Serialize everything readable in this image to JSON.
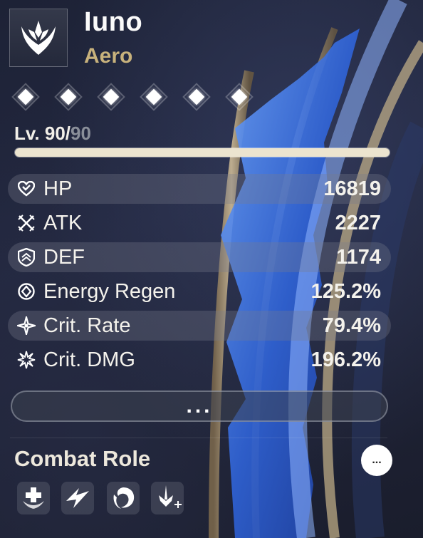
{
  "character": {
    "name": "Iuno",
    "element": "Aero",
    "emblem_icon": "aero-emblem-icon"
  },
  "sequence": {
    "nodes": [
      {
        "icon": "sequence-diamond-icon",
        "active": true
      },
      {
        "icon": "sequence-diamond-icon",
        "active": true
      },
      {
        "icon": "sequence-diamond-icon",
        "active": true
      },
      {
        "icon": "sequence-diamond-icon",
        "active": true
      },
      {
        "icon": "sequence-diamond-icon",
        "active": true
      },
      {
        "icon": "sequence-diamond-icon",
        "active": true
      }
    ]
  },
  "level": {
    "prefix": "Lv. 90/",
    "max": "90",
    "progress_percent": 100
  },
  "stats": [
    {
      "icon": "hp-heart-icon",
      "label": "HP",
      "value": "16819"
    },
    {
      "icon": "atk-swords-icon",
      "label": "ATK",
      "value": "2227"
    },
    {
      "icon": "def-shield-icon",
      "label": "DEF",
      "value": "1174"
    },
    {
      "icon": "energy-regen-icon",
      "label": "Energy Regen",
      "value": "125.2%"
    },
    {
      "icon": "crit-rate-star-icon",
      "label": "Crit. Rate",
      "value": "79.4%"
    },
    {
      "icon": "crit-dmg-burst-icon",
      "label": "Crit. DMG",
      "value": "196.2%"
    }
  ],
  "more_button": {
    "label": "..."
  },
  "combat_role": {
    "title": "Combat Role",
    "more_label": "...",
    "roles": [
      {
        "icon": "healing-role-icon"
      },
      {
        "icon": "aero-erosion-role-icon"
      },
      {
        "icon": "swirl-role-icon"
      },
      {
        "icon": "sword-boost-role-icon"
      }
    ]
  }
}
